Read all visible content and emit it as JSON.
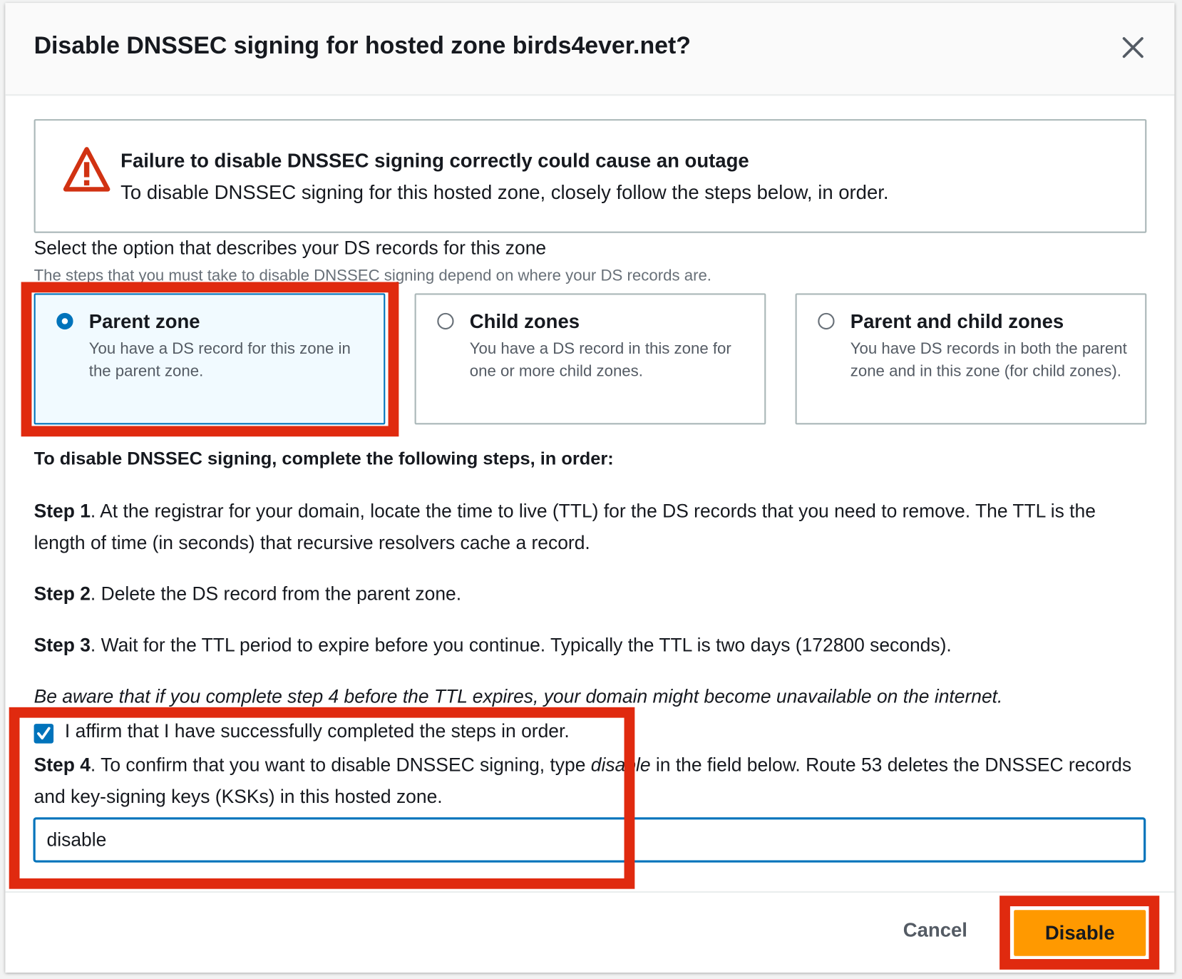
{
  "dialog": {
    "title": "Disable DNSSEC signing for hosted zone birds4ever.net?",
    "close_icon": "close-icon"
  },
  "alert": {
    "icon": "warning-triangle-icon",
    "title": "Failure to disable DNSSEC signing correctly could cause an outage",
    "text": "To disable DNSSEC signing for this hosted zone, closely follow the steps below, in order."
  },
  "ds_option": {
    "label": "Select the option that describes your DS records for this zone",
    "description": "The steps that you must take to disable DNSSEC signing depend on where your DS records are.",
    "options": [
      {
        "title": "Parent zone",
        "desc": "You have a DS record for this zone in the parent zone.",
        "selected": true
      },
      {
        "title": "Child zones",
        "desc": "You have a DS record in this zone for one or more child zones.",
        "selected": false
      },
      {
        "title": "Parent and child zones",
        "desc": "You have DS records in both the parent zone and in this zone (for child zones).",
        "selected": false
      }
    ]
  },
  "steps": {
    "heading": "To disable DNSSEC signing, complete the following steps, in order:",
    "step1_label": "Step 1",
    "step1_text": ". At the registrar for your domain, locate the time to live (TTL) for the DS records that you need to remove. The TTL is the length of time (in seconds) that recursive resolvers cache a record.",
    "step2_label": "Step 2",
    "step2_text": ". Delete the DS record from the parent zone.",
    "step3_label": "Step 3",
    "step3_text": ". Wait for the TTL period to expire before you continue. Typically the TTL is two days (172800 seconds).",
    "warning": "Be aware that if you complete step 4 before the TTL expires, your domain might become unavailable on the internet.",
    "affirm_label": "I affirm that I have successfully completed the steps in order.",
    "affirm_checked": true,
    "step4_label": "Step 4",
    "step4_text_a": ". To confirm that you want to disable DNSSEC signing, type ",
    "step4_keyword": "disable",
    "step4_text_b": " in the field below. Route 53 deletes the DNSSEC records and key-signing keys (KSKs) in this hosted zone.",
    "confirm_value": "disable"
  },
  "footer": {
    "cancel_label": "Cancel",
    "disable_label": "Disable"
  },
  "colors": {
    "accent": "#0073bb",
    "primary_button": "#ff9900",
    "warning": "#d13212",
    "highlight": "#e02a0f"
  }
}
